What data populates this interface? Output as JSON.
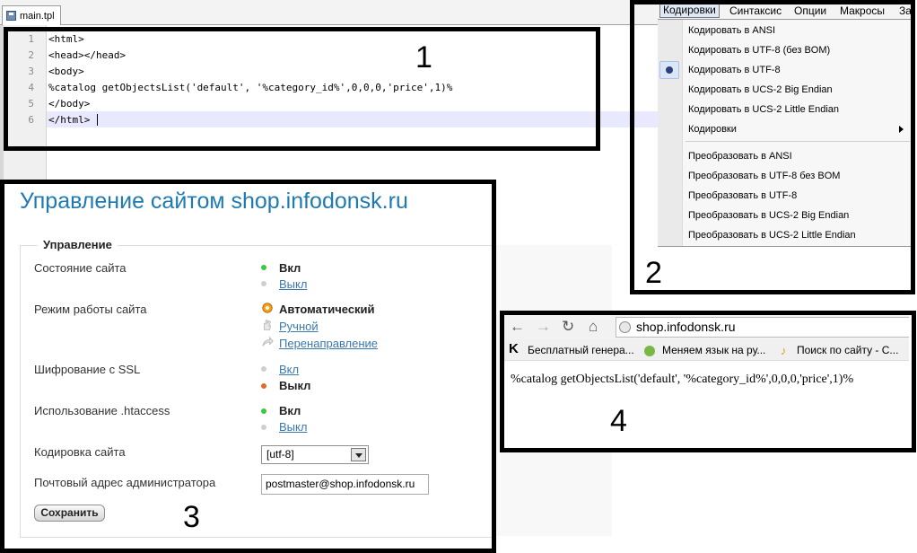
{
  "editor": {
    "tab_label": "main.tpl",
    "line_numbers": [
      "1",
      "2",
      "3",
      "4",
      "5",
      "6"
    ],
    "lines": [
      "<html>",
      "<head></head>",
      "<body>",
      "%catalog getObjectsList('default', '%category_id%',0,0,0,'price',1)%",
      "</body>",
      "</html>"
    ]
  },
  "annotations": {
    "n1": "1",
    "n2": "2",
    "n3": "3",
    "n4": "4"
  },
  "menu": {
    "bar": [
      "Кодировки",
      "Синтаксис",
      "Опции",
      "Макросы",
      "За"
    ],
    "items_group1": [
      "Кодировать в ANSI",
      "Кодировать в UTF-8 (без BOM)",
      "Кодировать в UTF-8",
      "Кодировать в UCS-2 Big Endian",
      "Кодировать в UCS-2 Little Endian",
      "Кодировки"
    ],
    "items_group2": [
      "Преобразовать в ANSI",
      "Преобразовать в UTF-8 без BOM",
      "Преобразовать в UTF-8",
      "Преобразовать в UCS-2 Big Endian",
      "Преобразовать в UCS-2 Little Endian"
    ]
  },
  "admin": {
    "title": "Управление сайтом shop.infodonsk.ru",
    "legend": "Управление",
    "site_state": {
      "label": "Состояние сайта",
      "on": "Вкл",
      "off": "Выкл"
    },
    "mode": {
      "label": "Режим работы сайта",
      "auto": "Автоматический",
      "manual": "Ручной",
      "redirect": "Перенаправление"
    },
    "ssl": {
      "label": "Шифрование с SSL",
      "on": "Вкл",
      "off": "Выкл"
    },
    "htaccess": {
      "label": "Использование .htaccess",
      "on": "Вкл",
      "off": "Выкл"
    },
    "encoding": {
      "label": "Кодировка сайта",
      "value": "[utf-8]"
    },
    "email": {
      "label": "Почтовый адрес администратора",
      "value": "postmaster@shop.infodonsk.ru"
    },
    "save_label": "Сохранить"
  },
  "browser": {
    "url": "shop.infodonsk.ru",
    "bookmarks": [
      "Бесплатный генера...",
      "Меняем язык на ру...",
      "Поиск по сайту - С..."
    ],
    "page_text": "%catalog getObjectsList('default', '%category_id%',0,0,0,'price',1)%"
  },
  "colors": {
    "title_blue": "#1f7ab3",
    "link_blue": "#3a78b0",
    "status_on": "#3cc93c",
    "status_off": "#cfcfcf",
    "status_selected": "#e8662a",
    "highlight_line": "#e8e8ff"
  }
}
